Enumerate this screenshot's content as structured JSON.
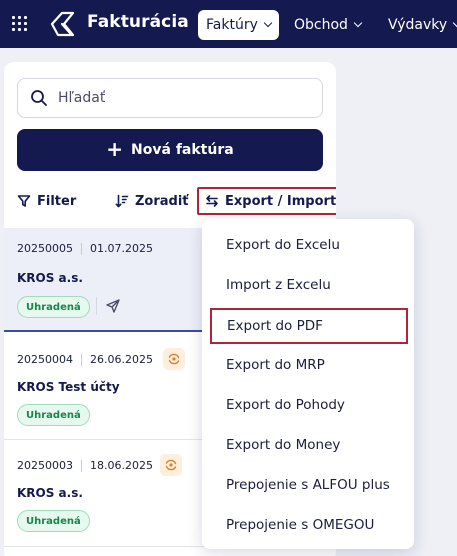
{
  "header": {
    "brand": "Fakturácia",
    "nav": [
      {
        "label": "Faktúry",
        "active": true
      },
      {
        "label": "Obchod",
        "active": false
      },
      {
        "label": "Výdavky",
        "active": false
      }
    ]
  },
  "sidebar": {
    "search_placeholder": "Hľadať",
    "new_button": "Nová faktúra",
    "filter_label": "Filter",
    "sort_label": "Zoradiť",
    "export_label": "Export / Import"
  },
  "invoices": [
    {
      "number": "20250005",
      "date": "01.07.2025",
      "client": "KROS a.s.",
      "status": "Uhradená"
    },
    {
      "number": "20250004",
      "date": "26.06.2025",
      "client": "KROS Test účty",
      "status": "Uhradená"
    },
    {
      "number": "20250003",
      "date": "18.06.2025",
      "client": "KROS a.s.",
      "status": "Uhradená"
    }
  ],
  "export_menu": [
    "Export do Excelu",
    "Import z Excelu",
    "Export do PDF",
    "Export do MRP",
    "Export do Pohody",
    "Export do Money",
    "Prepojenie s ALFOU plus",
    "Prepojenie s OMEGOU"
  ],
  "colors": {
    "navy": "#141a4f",
    "highlight": "#b0243a",
    "paid_green": "#19864b"
  }
}
